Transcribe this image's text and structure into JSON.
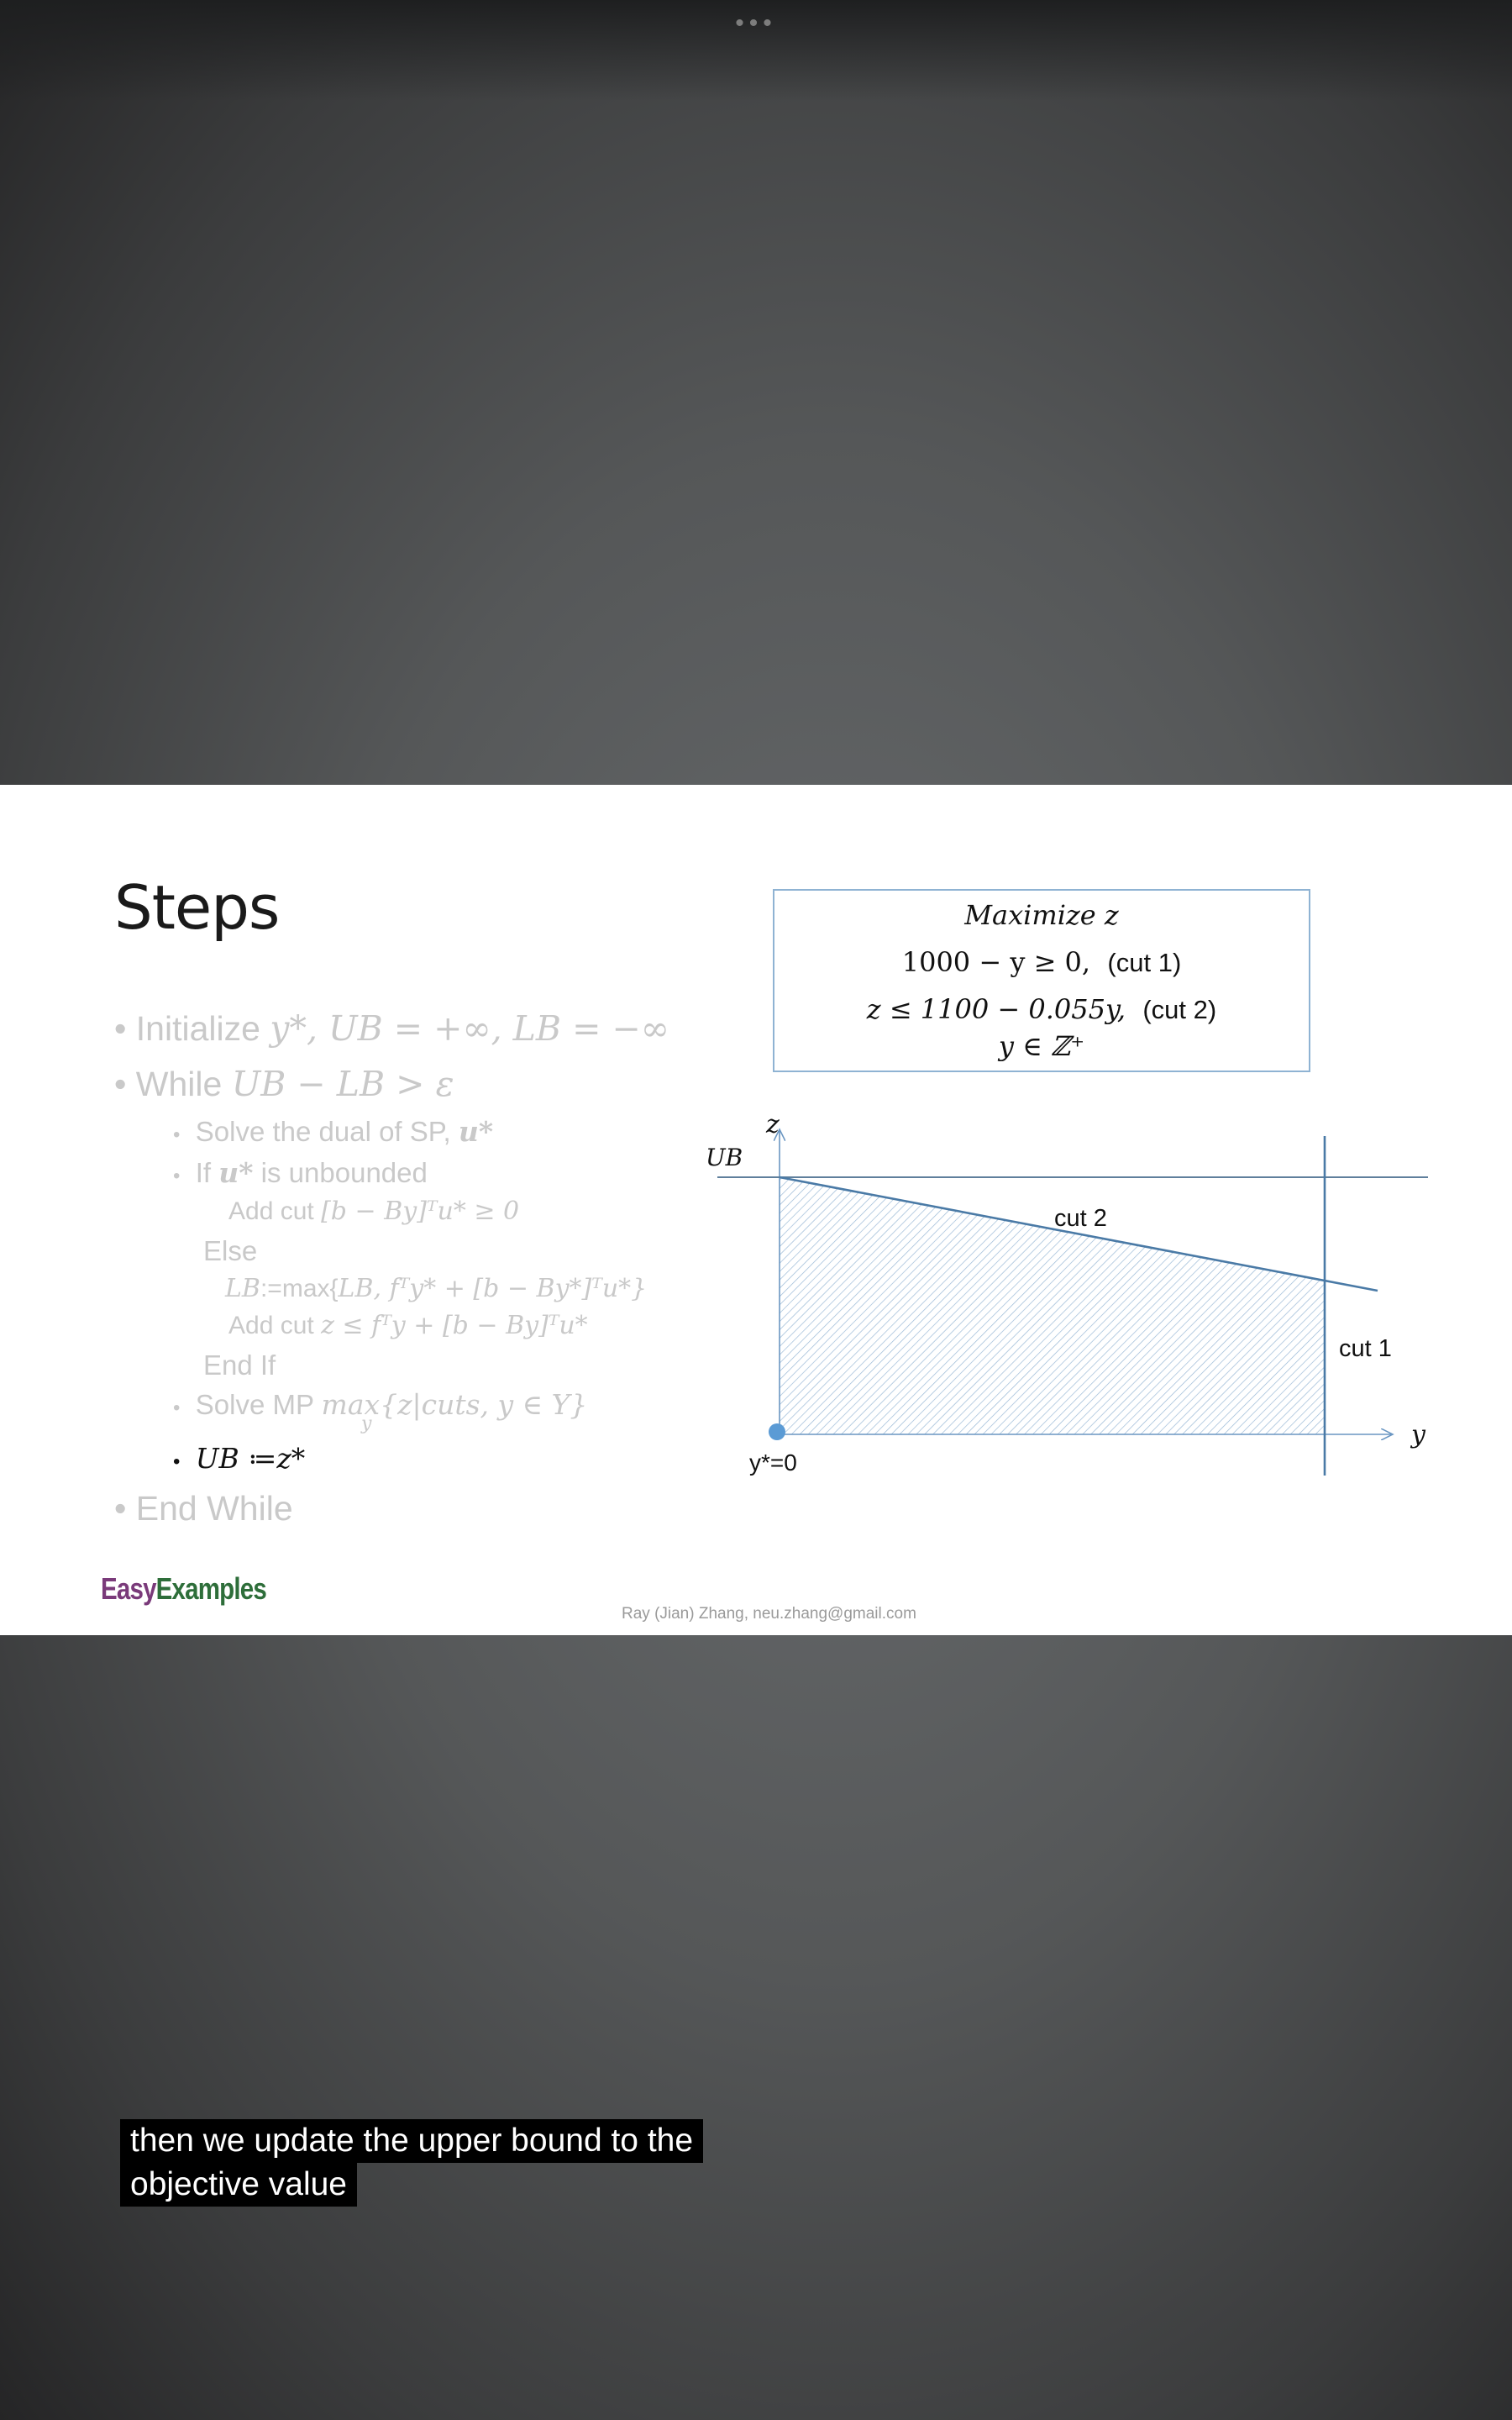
{
  "player": {
    "more_glyph": "•••"
  },
  "slide": {
    "title": "Steps",
    "bullets": {
      "b1_text": "Initialize ",
      "b1_math": "y*, UB = +∞, LB = −∞",
      "b2_text": "While ",
      "b2_math": "UB − LB > ε",
      "b3_text": "Solve the dual of SP, ",
      "b3_math": "u*",
      "b4_pre": "If ",
      "b4_math": "u*",
      "b4_post": " is unbounded",
      "b5_text": "Add cut ",
      "b5_math": "[b − By]ᵀu* ≥ 0",
      "b6_text": "Else",
      "b7_math_a": "LB",
      "b7_text": ":=max{",
      "b7_math_b": "LB, fᵀy* + [b − By*]ᵀu*}",
      "b8_text": "Add cut ",
      "b8_math": "z ≤ fᵀy + [b − By]ᵀu*",
      "b9_text": "End If",
      "b10_text": "Solve MP ",
      "b10_math": "max{z|cuts, y ∈ Y}",
      "b10_sub": "y",
      "b11_math": "UB ≔z*",
      "b12_text": "End While"
    },
    "formula": {
      "line1": "Maximize z",
      "line2_math": "1000 − y ≥ 0,",
      "line2_label": "(cut 1)",
      "line3_math": "z ≤ 1100 − 0.055y,",
      "line3_label": "(cut 2)",
      "line4": "y ∈ ℤ⁺"
    },
    "graph": {
      "z_axis_label": "z",
      "y_axis_label": "y",
      "ub_label": "UB",
      "cut2_label": "cut 2",
      "cut1_label": "cut 1",
      "ystar_label": "y*=0",
      "line_color": "#4a7aa6",
      "point_color": "#5b9bd5"
    },
    "logo": {
      "easy": "Easy",
      "examples": "Examples"
    },
    "footer": "Ray (Jian) Zhang, neu.zhang@gmail.com"
  },
  "caption": {
    "line1": "then we update the upper bound to the",
    "line2": "objective value"
  }
}
